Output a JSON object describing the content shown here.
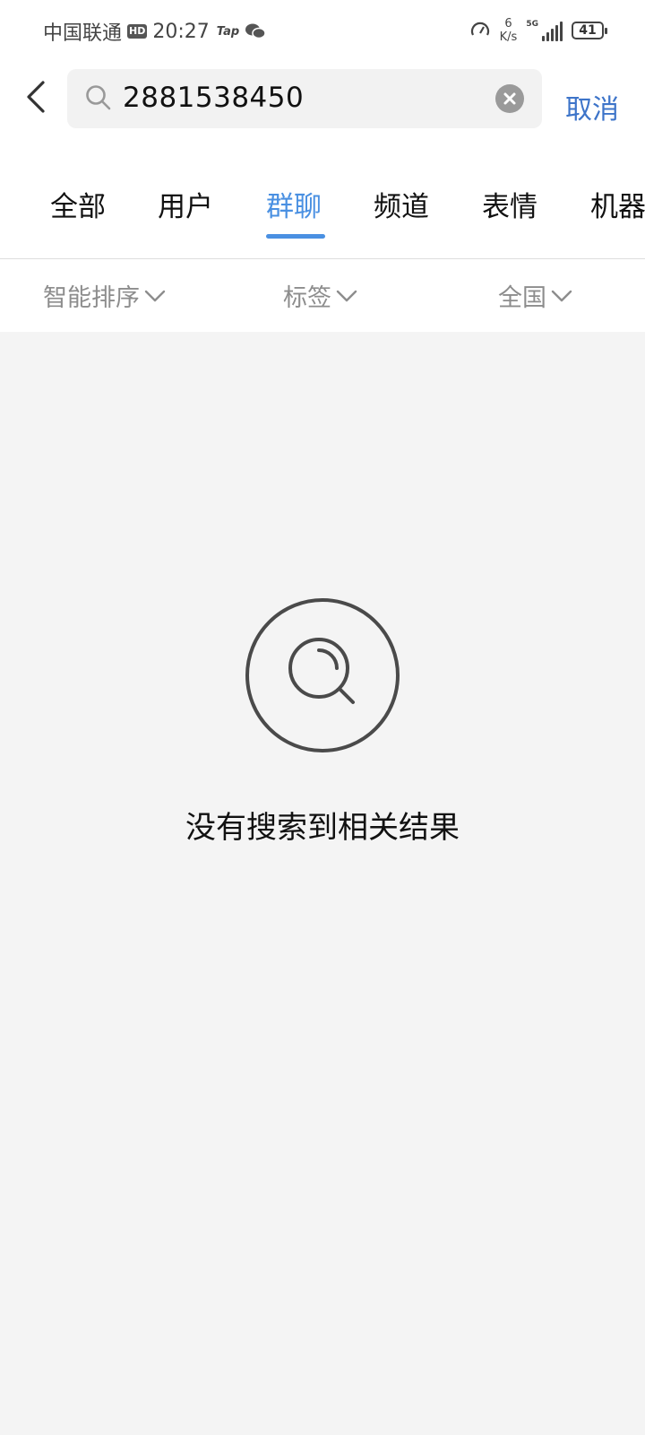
{
  "status_bar": {
    "carrier": "中国联通",
    "hd_badge": "HD",
    "time": "20:27",
    "tap_label": "Tap",
    "speed_value": "6",
    "speed_unit": "K/s",
    "network_label": "5G",
    "battery": "41"
  },
  "search": {
    "value": "2881538450",
    "cancel_label": "取消"
  },
  "tabs": [
    {
      "label": "全部"
    },
    {
      "label": "用户"
    },
    {
      "label": "群聊"
    },
    {
      "label": "频道"
    },
    {
      "label": "表情"
    },
    {
      "label": "机器"
    }
  ],
  "active_tab": "群聊",
  "filters": [
    {
      "label": "智能排序"
    },
    {
      "label": "标签"
    },
    {
      "label": "全国"
    }
  ],
  "empty_state": {
    "message": "没有搜索到相关结果"
  },
  "colors": {
    "accent": "#4a90e2",
    "cancel": "#3d74c9",
    "background": "#f4f4f4"
  }
}
